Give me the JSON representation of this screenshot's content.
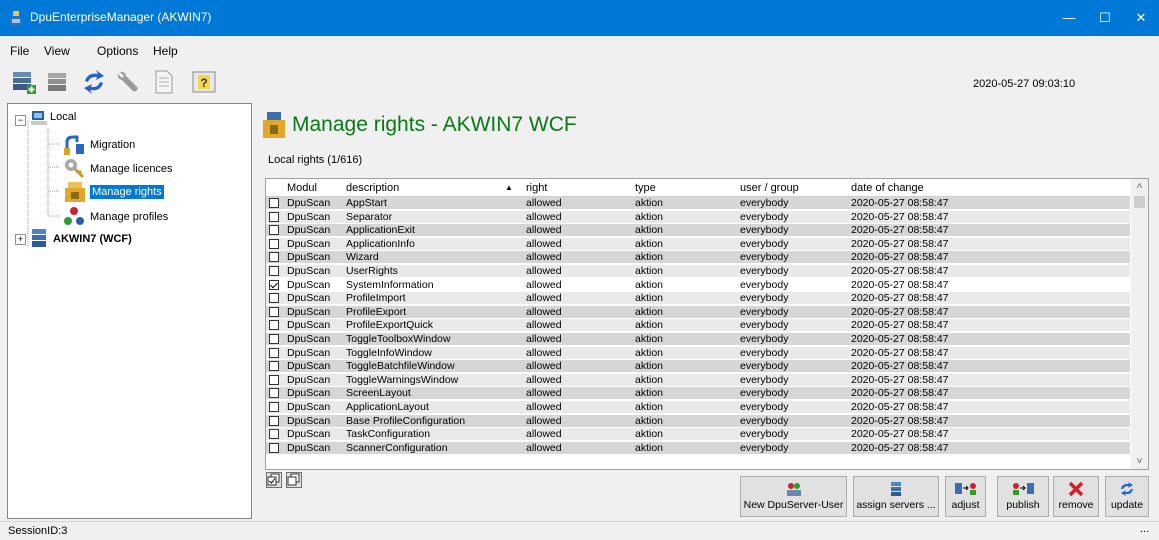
{
  "window": {
    "title": "DpuEnterpriseManager (AKWIN7)",
    "minimize": "—",
    "maximize": "☐",
    "close": "✕"
  },
  "menu": [
    "File",
    "View",
    "Options",
    "Help"
  ],
  "toolbar": {
    "icons": [
      "database-add-icon",
      "database-icon",
      "refresh-icon",
      "wrench-icon",
      "document-icon",
      "help-icon"
    ],
    "datetime": "2020-05-27 09:03:10"
  },
  "tree": {
    "root": "Local",
    "children": [
      "Migration",
      "Manage licences",
      "Manage rights",
      "Manage profiles"
    ],
    "selected": "Manage rights",
    "server": "AKWIN7 (WCF)"
  },
  "main": {
    "title": "Manage rights - AKWIN7 WCF",
    "subtitle": "Local rights (1/616)",
    "columns": [
      "Modul",
      "description",
      "right",
      "type",
      "user / group",
      "date of change"
    ],
    "sort_indicator": "▲",
    "rows": [
      {
        "checked": false,
        "modul": "DpuScan",
        "description": "AppStart",
        "right": "allowed",
        "type": "aktion",
        "user": "everybody",
        "date": "2020-05-27 08:58:47"
      },
      {
        "checked": false,
        "modul": "DpuScan",
        "description": "Separator",
        "right": "allowed",
        "type": "aktion",
        "user": "everybody",
        "date": "2020-05-27 08:58:47"
      },
      {
        "checked": false,
        "modul": "DpuScan",
        "description": "ApplicationExit",
        "right": "allowed",
        "type": "aktion",
        "user": "everybody",
        "date": "2020-05-27 08:58:47"
      },
      {
        "checked": false,
        "modul": "DpuScan",
        "description": "ApplicationInfo",
        "right": "allowed",
        "type": "aktion",
        "user": "everybody",
        "date": "2020-05-27 08:58:47"
      },
      {
        "checked": false,
        "modul": "DpuScan",
        "description": "Wizard",
        "right": "allowed",
        "type": "aktion",
        "user": "everybody",
        "date": "2020-05-27 08:58:47"
      },
      {
        "checked": false,
        "modul": "DpuScan",
        "description": "UserRights",
        "right": "allowed",
        "type": "aktion",
        "user": "everybody",
        "date": "2020-05-27 08:58:47"
      },
      {
        "checked": true,
        "modul": "DpuScan",
        "description": "SystemInformation",
        "right": "allowed",
        "type": "aktion",
        "user": "everybody",
        "date": "2020-05-27 08:58:47"
      },
      {
        "checked": false,
        "modul": "DpuScan",
        "description": "ProfileImport",
        "right": "allowed",
        "type": "aktion",
        "user": "everybody",
        "date": "2020-05-27 08:58:47"
      },
      {
        "checked": false,
        "modul": "DpuScan",
        "description": "ProfileExport",
        "right": "allowed",
        "type": "aktion",
        "user": "everybody",
        "date": "2020-05-27 08:58:47"
      },
      {
        "checked": false,
        "modul": "DpuScan",
        "description": "ProfileExportQuick",
        "right": "allowed",
        "type": "aktion",
        "user": "everybody",
        "date": "2020-05-27 08:58:47"
      },
      {
        "checked": false,
        "modul": "DpuScan",
        "description": "ToggleToolboxWindow",
        "right": "allowed",
        "type": "aktion",
        "user": "everybody",
        "date": "2020-05-27 08:58:47"
      },
      {
        "checked": false,
        "modul": "DpuScan",
        "description": "ToggleInfoWindow",
        "right": "allowed",
        "type": "aktion",
        "user": "everybody",
        "date": "2020-05-27 08:58:47"
      },
      {
        "checked": false,
        "modul": "DpuScan",
        "description": "ToggleBatchfileWindow",
        "right": "allowed",
        "type": "aktion",
        "user": "everybody",
        "date": "2020-05-27 08:58:47"
      },
      {
        "checked": false,
        "modul": "DpuScan",
        "description": "ToggleWarningsWindow",
        "right": "allowed",
        "type": "aktion",
        "user": "everybody",
        "date": "2020-05-27 08:58:47"
      },
      {
        "checked": false,
        "modul": "DpuScan",
        "description": "ScreenLayout",
        "right": "allowed",
        "type": "aktion",
        "user": "everybody",
        "date": "2020-05-27 08:58:47"
      },
      {
        "checked": false,
        "modul": "DpuScan",
        "description": "ApplicationLayout",
        "right": "allowed",
        "type": "aktion",
        "user": "everybody",
        "date": "2020-05-27 08:58:47"
      },
      {
        "checked": false,
        "modul": "DpuScan",
        "description": "Base ProfileConfiguration",
        "right": "allowed",
        "type": "aktion",
        "user": "everybody",
        "date": "2020-05-27 08:58:47"
      },
      {
        "checked": false,
        "modul": "DpuScan",
        "description": "TaskConfiguration",
        "right": "allowed",
        "type": "aktion",
        "user": "everybody",
        "date": "2020-05-27 08:58:47"
      },
      {
        "checked": false,
        "modul": "DpuScan",
        "description": "ScannerConfiguration",
        "right": "allowed",
        "type": "aktion",
        "user": "everybody",
        "date": "2020-05-27 08:58:47"
      }
    ],
    "buttons": {
      "new_user": "New DpuServer-User",
      "assign": "assign servers ...",
      "adjust": "adjust",
      "publish": "publish",
      "remove": "remove",
      "update": "update"
    }
  },
  "status": {
    "session": "SessionID:3",
    "grip": "..."
  }
}
